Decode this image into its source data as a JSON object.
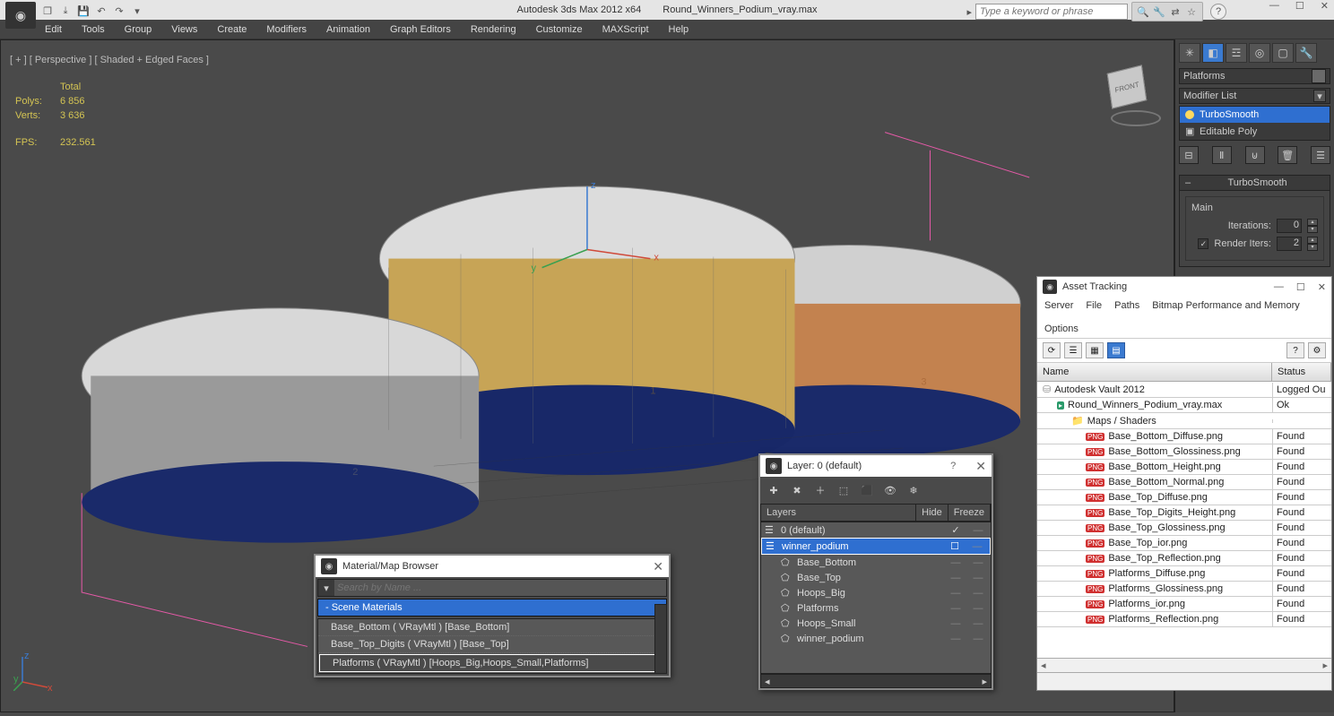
{
  "app": {
    "title_left": "Autodesk 3ds Max  2012 x64",
    "filename": "Round_Winners_Podium_vray.max"
  },
  "search": {
    "placeholder": "Type a keyword or phrase"
  },
  "menu": [
    "Edit",
    "Tools",
    "Group",
    "Views",
    "Create",
    "Modifiers",
    "Animation",
    "Graph Editors",
    "Rendering",
    "Customize",
    "MAXScript",
    "Help"
  ],
  "viewport": {
    "label": "[ + ] [ Perspective ] [ Shaded + Edged Faces ]",
    "stats": {
      "total_label": "Total",
      "polys_label": "Polys:",
      "polys": "6 856",
      "verts_label": "Verts:",
      "verts": "3 636",
      "fps_label": "FPS:",
      "fps": "232.561"
    },
    "cube_face": "FRONT"
  },
  "command_panel": {
    "object_name": "Platforms",
    "modifier_list_label": "Modifier List",
    "stack": [
      {
        "name": "TurboSmooth",
        "selected": true,
        "icon": "bulb"
      },
      {
        "name": "Editable Poly",
        "selected": false,
        "icon": "plus"
      }
    ],
    "rollout_title": "TurboSmooth",
    "group_label": "Main",
    "iterations_label": "Iterations:",
    "iterations": "0",
    "render_iters_label": "Render Iters:",
    "render_iters": "2",
    "render_iters_checked": true
  },
  "material_browser": {
    "title": "Material/Map Browser",
    "search_placeholder": "Search by Name ...",
    "group": "- Scene Materials",
    "items": [
      "Base_Bottom ( VRayMtl ) [Base_Bottom]",
      "Base_Top_Digits ( VRayMtl ) [Base_Top]",
      "Platforms ( VRayMtl ) [Hoops_Big,Hoops_Small,Platforms]"
    ],
    "selected_index": 2
  },
  "layer_panel": {
    "title": "Layer: 0 (default)",
    "columns": {
      "c1": "Layers",
      "c2": "Hide",
      "c3": "Freeze"
    },
    "rows": [
      {
        "name": "0 (default)",
        "indent": 0,
        "sel": false,
        "check": true
      },
      {
        "name": "winner_podium",
        "indent": 0,
        "sel": true,
        "box": true
      },
      {
        "name": "Base_Bottom",
        "indent": 1
      },
      {
        "name": "Base_Top",
        "indent": 1
      },
      {
        "name": "Hoops_Big",
        "indent": 1
      },
      {
        "name": "Platforms",
        "indent": 1
      },
      {
        "name": "Hoops_Small",
        "indent": 1
      },
      {
        "name": "winner_podium",
        "indent": 1
      }
    ]
  },
  "asset_tracking": {
    "title": "Asset Tracking",
    "menu": [
      "Server",
      "File",
      "Paths",
      "Bitmap Performance and Memory",
      "Options"
    ],
    "columns": {
      "name": "Name",
      "status": "Status"
    },
    "rows": [
      {
        "icon": "vault",
        "name": "Autodesk Vault 2012",
        "status": "Logged Ou",
        "indent": 0
      },
      {
        "icon": "max",
        "name": "Round_Winners_Podium_vray.max",
        "status": "Ok",
        "indent": 1
      },
      {
        "icon": "folder",
        "name": "Maps / Shaders",
        "status": "",
        "indent": 2
      },
      {
        "icon": "png",
        "name": "Base_Bottom_Diffuse.png",
        "status": "Found",
        "indent": 3
      },
      {
        "icon": "png",
        "name": "Base_Bottom_Glossiness.png",
        "status": "Found",
        "indent": 3
      },
      {
        "icon": "png",
        "name": "Base_Bottom_Height.png",
        "status": "Found",
        "indent": 3
      },
      {
        "icon": "png",
        "name": "Base_Bottom_Normal.png",
        "status": "Found",
        "indent": 3
      },
      {
        "icon": "png",
        "name": "Base_Top_Diffuse.png",
        "status": "Found",
        "indent": 3
      },
      {
        "icon": "png",
        "name": "Base_Top_Digits_Height.png",
        "status": "Found",
        "indent": 3
      },
      {
        "icon": "png",
        "name": "Base_Top_Glossiness.png",
        "status": "Found",
        "indent": 3
      },
      {
        "icon": "png",
        "name": "Base_Top_ior.png",
        "status": "Found",
        "indent": 3
      },
      {
        "icon": "png",
        "name": "Base_Top_Reflection.png",
        "status": "Found",
        "indent": 3
      },
      {
        "icon": "png",
        "name": "Platforms_Diffuse.png",
        "status": "Found",
        "indent": 3
      },
      {
        "icon": "png",
        "name": "Platforms_Glossiness.png",
        "status": "Found",
        "indent": 3
      },
      {
        "icon": "png",
        "name": "Platforms_ior.png",
        "status": "Found",
        "indent": 3
      },
      {
        "icon": "png",
        "name": "Platforms_Reflection.png",
        "status": "Found",
        "indent": 3
      }
    ]
  }
}
